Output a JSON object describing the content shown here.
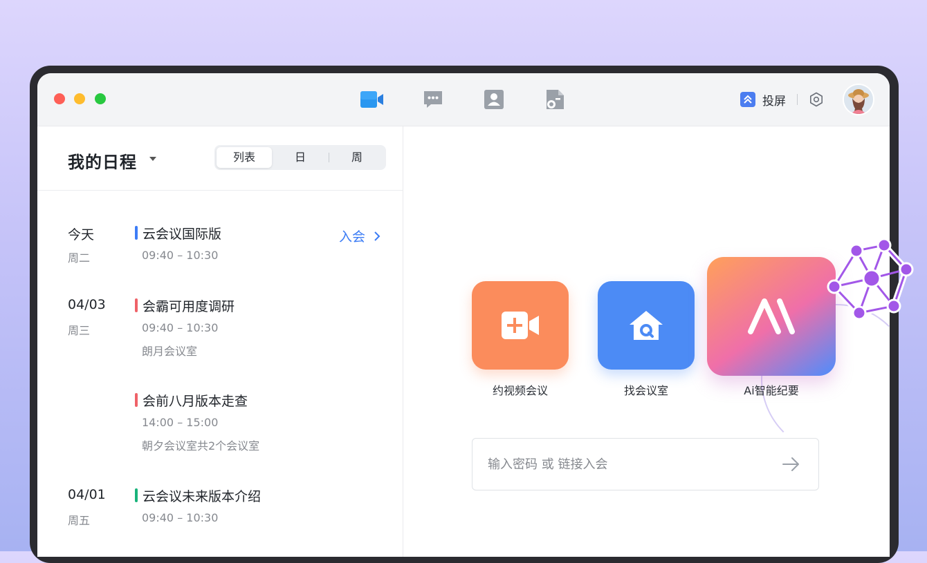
{
  "toolbar": {
    "nav_icons": [
      "video-meeting-icon",
      "chat-icon",
      "contacts-icon",
      "document-icon"
    ],
    "share_label": "投屏",
    "share_icon": "screen-share-icon",
    "settings_icon": "gear-icon"
  },
  "schedule": {
    "title": "我的日程",
    "views": [
      "列表",
      "日",
      "周"
    ],
    "active_view": "列表",
    "days": [
      {
        "date": "今天",
        "weekday": "周二",
        "events": [
          {
            "title": "云会议国际版",
            "time": "09:40 – 10:30",
            "color": "#3d7df6",
            "action": "入会"
          }
        ]
      },
      {
        "date": "04/03",
        "weekday": "周三",
        "events": [
          {
            "title": "会霸可用度调研",
            "time": "09:40 – 10:30",
            "room": "朗月会议室",
            "color": "#ef6268"
          },
          {
            "title": "会前八月版本走查",
            "time": "14:00 – 15:00",
            "room": "朝夕会议室共2个会议室",
            "color": "#ef6268"
          }
        ]
      },
      {
        "date": "04/01",
        "weekday": "周五",
        "events": [
          {
            "title": "云会议未来版本介绍",
            "time": "09:40 – 10:30",
            "color": "#19b37b"
          }
        ]
      }
    ]
  },
  "quick_actions": [
    {
      "label": "约视频会议",
      "icon": "video-plus-icon",
      "color": "#fb8c5c"
    },
    {
      "label": "找会议室",
      "icon": "room-search-icon",
      "color": "#4c8bf5"
    },
    {
      "label": "Ai智能纪要",
      "icon": "ai-logo-icon",
      "colors": [
        "#ffa05a",
        "#ef6fa9",
        "#4d8dfc"
      ]
    }
  ],
  "join_input": {
    "placeholder": "输入密码 或 链接入会",
    "value": ""
  },
  "colors": {
    "accent": "#3b7cf5",
    "window_traffic": [
      "#fe5f57",
      "#febc2e",
      "#28c840"
    ]
  }
}
